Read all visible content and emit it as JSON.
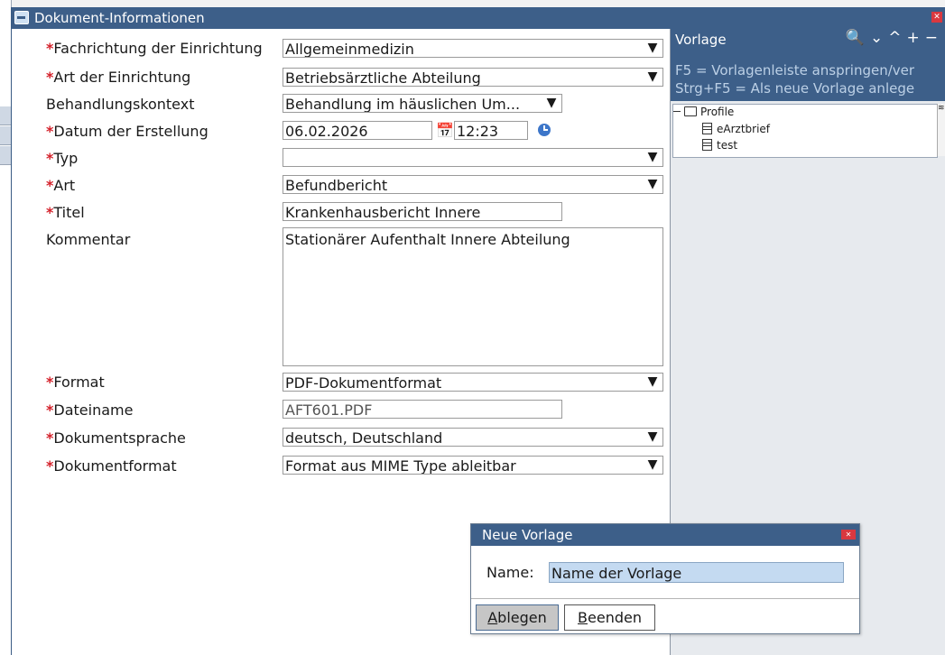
{
  "window": {
    "title": "Dokument-Informationen"
  },
  "form": {
    "fachrichtung": {
      "label": "Fachrichtung der Einrichtung",
      "required": true,
      "value": "Allgemeinmedizin"
    },
    "art_einrichtung": {
      "label": "Art der Einrichtung",
      "required": true,
      "value": "Betriebsärztliche Abteilung"
    },
    "behandlungskontext": {
      "label": "Behandlungskontext",
      "required": false,
      "value": "Behandlung im häuslichen Um..."
    },
    "datum": {
      "label": "Datum der Erstellung",
      "required": true,
      "date": "06.02.2026",
      "time": "12:23"
    },
    "typ": {
      "label": "Typ",
      "required": true,
      "value": ""
    },
    "art": {
      "label": "Art",
      "required": true,
      "value": "Befundbericht"
    },
    "titel": {
      "label": "Titel",
      "required": true,
      "value": "Krankenhausbericht Innere"
    },
    "kommentar": {
      "label": "Kommentar",
      "required": false,
      "value": "Stationärer Aufenthalt Innere Abteilung"
    },
    "format": {
      "label": "Format",
      "required": true,
      "value": "PDF-Dokumentformat"
    },
    "dateiname": {
      "label": "Dateiname",
      "required": true,
      "value": "AFT601.PDF"
    },
    "dokumentsprache": {
      "label": "Dokumentsprache",
      "required": true,
      "value": "deutsch, Deutschland"
    },
    "dokumentformat": {
      "label": "Dokumentformat",
      "required": true,
      "value": "Format aus MIME Type ableitbar"
    }
  },
  "required_marker": "*",
  "vorlage": {
    "title": "Vorlage",
    "hint1": "F5 = Vorlagenleiste anspringen/ver",
    "hint2": "Strg+F5 = Als neue Vorlage anlege",
    "tree": {
      "root": "Profile",
      "children": [
        "eArztbrief",
        "test"
      ]
    }
  },
  "dialog": {
    "title": "Neue Vorlage",
    "name_label": "Name:",
    "name_value": "Name der Vorlage",
    "ablegen_rest": "blegen",
    "ablegen_mnemonic": "A",
    "beenden_rest": "eenden",
    "beenden_mnemonic": "B"
  },
  "colors": {
    "titlebar": "#3d5f89",
    "required": "#d4202a",
    "input_highlight": "#c4daf1"
  }
}
